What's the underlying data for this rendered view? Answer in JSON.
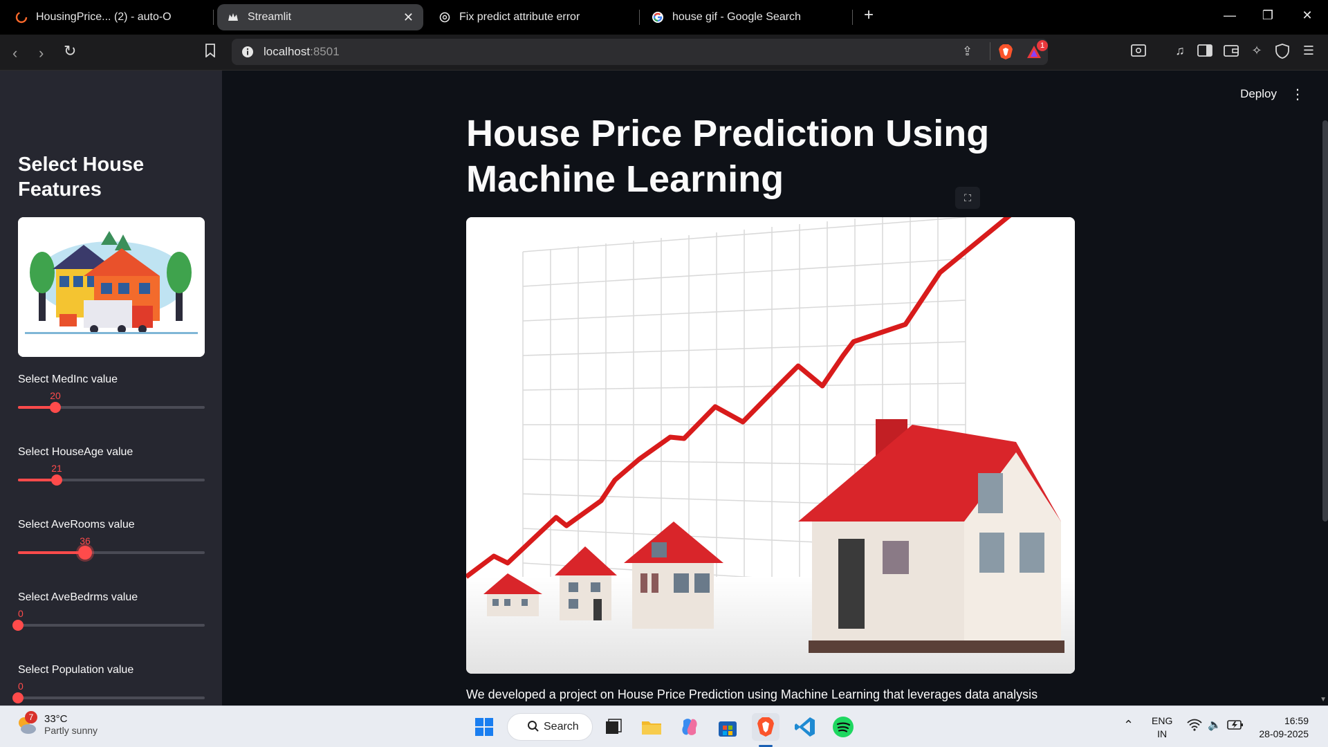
{
  "browser": {
    "tabs": [
      {
        "title": "HousingPrice... (2) - auto-O",
        "icon": "loading-ring-icon"
      },
      {
        "title": "Streamlit",
        "icon": "streamlit-crown-icon",
        "active": true
      },
      {
        "title": "Fix predict attribute error",
        "icon": "openai-icon"
      },
      {
        "title": "house gif - Google Search",
        "icon": "google-icon"
      }
    ],
    "new_tab": "+",
    "url_host": "localhost",
    "url_port": ":8501",
    "brave_rewards_badge": "1"
  },
  "app": {
    "deploy_label": "Deploy",
    "menu_icon": "kebab-menu-icon",
    "title": "House Price Prediction Using Machine Learning",
    "description": "We developed a project on House Price Prediction using Machine Learning that leverages data analysis",
    "accent_color": "#ff4b4b"
  },
  "sidebar": {
    "title": "Select House Features",
    "sliders": [
      {
        "label": "Select MedInc value",
        "value": "20",
        "fraction": 0.2
      },
      {
        "label": "Select HouseAge value",
        "value": "21",
        "fraction": 0.21
      },
      {
        "label": "Select AveRooms value",
        "value": "36",
        "fraction": 0.36
      },
      {
        "label": "Select AveBedrms value",
        "value": "0",
        "fraction": 0.0
      },
      {
        "label": "Select Population value",
        "value": "0",
        "fraction": 0.0
      }
    ]
  },
  "taskbar": {
    "weather_temp": "33°C",
    "weather_cond": "Partly sunny",
    "weather_badge": "7",
    "search_label": "Search",
    "lang_line1": "ENG",
    "lang_line2": "IN",
    "time": "16:59",
    "date": "28-09-2025"
  }
}
